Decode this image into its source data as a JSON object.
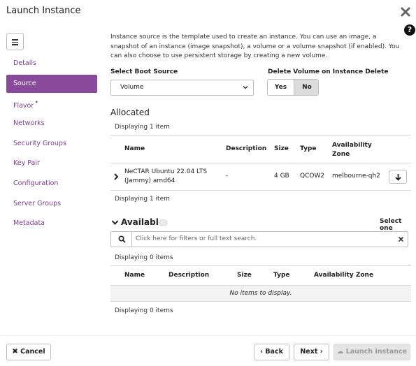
{
  "header": {
    "title": "Launch Instance",
    "help": "?"
  },
  "sidebar": {
    "items": [
      {
        "label": "Details"
      },
      {
        "label": "Source"
      },
      {
        "label": "Flavor",
        "required": "*"
      },
      {
        "label": "Networks"
      },
      {
        "label": "Security Groups"
      },
      {
        "label": "Key Pair"
      },
      {
        "label": "Configuration"
      },
      {
        "label": "Server Groups"
      },
      {
        "label": "Metadata"
      }
    ],
    "active_index": 1
  },
  "source": {
    "intro": "Instance source is the template used to create an instance. You can use an image, a snapshot of an instance (image snapshot), a volume or a volume snapshot (if enabled). You can also choose to use persistent storage by creating a new volume.",
    "boot_source_label": "Select Boot Source",
    "boot_source_value": "Volume",
    "delete_volume_label": "Delete Volume on Instance Delete",
    "yes_label": "Yes",
    "no_label": "No",
    "delete_volume_selected": "No"
  },
  "allocated": {
    "title": "Allocated",
    "displaying_top": "Displaying 1 item",
    "displaying_bottom": "Displaying 1 item",
    "columns": [
      "Name",
      "Description",
      "Size",
      "Type",
      "Availability Zone"
    ],
    "rows": [
      {
        "name": "NeCTAR Ubuntu 22.04 LTS (Jammy) amd64",
        "description": "-",
        "size": "4 GB",
        "type": "QCOW2",
        "zone": "melbourne-qh2"
      }
    ]
  },
  "available": {
    "title": "Available",
    "count": "0",
    "select_one": "Select one",
    "search_placeholder": "Click here for filters or full text search.",
    "displaying_top": "Displaying 0 items",
    "displaying_bottom": "Displaying 0 items",
    "columns": [
      "Name",
      "Description",
      "Size",
      "Type",
      "Availability Zone"
    ],
    "empty_text": "No items to display."
  },
  "footer": {
    "cancel_label": "Cancel",
    "back_label": "Back",
    "next_label": "Next",
    "launch_label": "Launch Instance"
  },
  "colors": {
    "accent": "#8a4a9c",
    "nav_text": "#7b3a8f"
  }
}
